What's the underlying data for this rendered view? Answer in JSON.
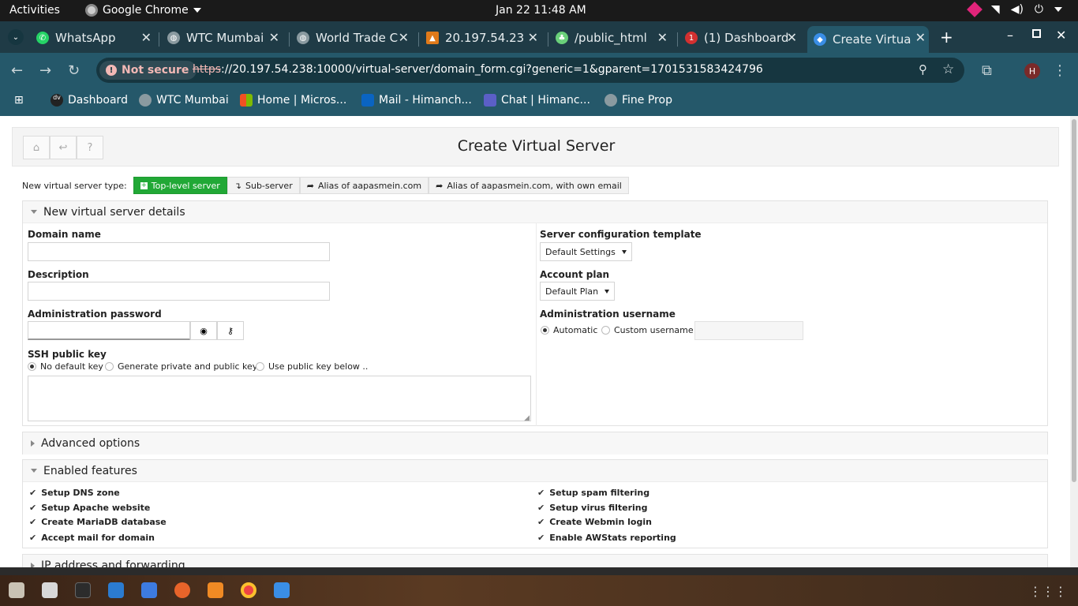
{
  "topbar": {
    "activities": "Activities",
    "app": "Google Chrome",
    "clock": "Jan 22  11:48 AM"
  },
  "tabs": [
    {
      "title": "WhatsApp",
      "color": "#25d366"
    },
    {
      "title": "WTC Mumbai",
      "color": "#8a9aa0"
    },
    {
      "title": "World Trade C",
      "color": "#8a9aa0"
    },
    {
      "title": "20.197.54.23",
      "color": "#e07a1a"
    },
    {
      "title": "/public_html",
      "color": "#6ad07a"
    },
    {
      "title": "(1) Dashboard",
      "color": "#d23030"
    },
    {
      "title": "Create Virtua",
      "color": "#3a8ee6"
    }
  ],
  "address": {
    "not_secure": "Not secure",
    "scheme": "https",
    "rest": "://20.197.54.238:10000/virtual-server/domain_form.cgi?generic=1&gparent=1701531583424796",
    "profile_initial": "H"
  },
  "bookmarks": [
    "Dashboard",
    "WTC Mumbai",
    "Home | Micros...",
    "Mail - Himanch...",
    "Chat | Himanc...",
    "Fine Prop"
  ],
  "page": {
    "title": "Create Virtual Server",
    "type_label": "New virtual server type:",
    "type_options": [
      "Top-level server",
      "Sub-server",
      "Alias of aapasmein.com",
      "Alias of aapasmein.com, with own email"
    ],
    "details_header": "New virtual server details",
    "domain_name_label": "Domain name",
    "description_label": "Description",
    "admin_password_label": "Administration password",
    "ssh_key_label": "SSH public key",
    "ssh_options": [
      "No default key",
      "Generate private and public keys",
      "Use public key below .."
    ],
    "template_label": "Server configuration template",
    "template_value": "Default Settings",
    "plan_label": "Account plan",
    "plan_value": "Default Plan",
    "admin_user_label": "Administration username",
    "admin_user_options": [
      "Automatic",
      "Custom username"
    ],
    "advanced_header": "Advanced options",
    "features_header": "Enabled features",
    "features_left": [
      "Setup DNS zone",
      "Setup Apache website",
      "Create MariaDB database",
      "Accept mail for domain"
    ],
    "features_right": [
      "Setup spam filtering",
      "Setup virus filtering",
      "Create Webmin login",
      "Enable AWStats reporting"
    ],
    "ip_header": "IP address and forwarding"
  }
}
